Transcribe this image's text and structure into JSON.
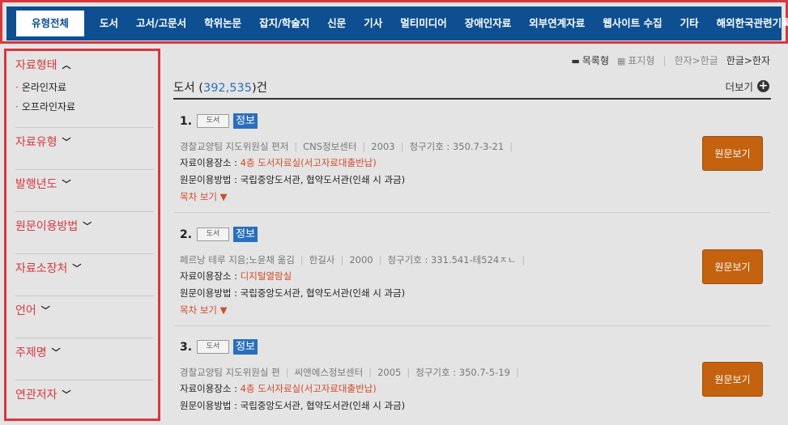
{
  "nav": {
    "tabs": [
      "유형전체",
      "도서",
      "고서/고문서",
      "학위논문",
      "잡지/학술지",
      "신문",
      "기사",
      "멀티미디어",
      "장애인자료",
      "외부연계자료",
      "웹사이트 수집",
      "기타",
      "해외한국관련기록물"
    ],
    "active_index": 0
  },
  "sidebar": {
    "filters": [
      {
        "label": "자료형태",
        "expanded": true,
        "options": [
          "온라인자료",
          "오프라인자료"
        ]
      },
      {
        "label": "자료유형",
        "expanded": false
      },
      {
        "label": "발행년도",
        "expanded": false
      },
      {
        "label": "원문이용방법",
        "expanded": false
      },
      {
        "label": "자료소장처",
        "expanded": false
      },
      {
        "label": "언어",
        "expanded": false
      },
      {
        "label": "주제명",
        "expanded": false
      },
      {
        "label": "연관저자",
        "expanded": false
      }
    ]
  },
  "view": {
    "list_label": "목록형",
    "card_label": "표지형",
    "hanja_to_hangul": "한자>한글",
    "hangul_to_hanja": "한글>한자",
    "active_view": "목록형"
  },
  "results_header": {
    "category": "도서",
    "count": "392,535",
    "suffix": "건",
    "more_label": "더보기"
  },
  "results": [
    {
      "no": "1.",
      "type_badge": "도서",
      "title": "정보",
      "meta": [
        "경찰교양팀 지도위원실 편저",
        "CNS정보센터",
        "2003",
        "청구기호 : 350.7-3-21"
      ],
      "location_label": "자료이용장소 :",
      "location_value": "4층 도서자료실(서고자료대출반납)",
      "method_label": "원문이용방법 :",
      "method_value": "국립중앙도서관, 협약도서관(인쇄 시 과금)",
      "toc_label": "목차 보기 ▼",
      "button_label": "원문보기"
    },
    {
      "no": "2.",
      "type_badge": "도서",
      "title": "정보",
      "meta": [
        "페르낭 테루 지음;노윤채 옮김",
        "한길사",
        "2000",
        "청구기호 : 331.541-테524ㅈㄴ"
      ],
      "location_label": "자료이용장소 :",
      "location_value": "디지털열람실",
      "method_label": "원문이용방법 :",
      "method_value": "국립중앙도서관, 협약도서관(인쇄 시 과금)",
      "toc_label": "목차 보기 ▼",
      "button_label": "원문보기"
    },
    {
      "no": "3.",
      "type_badge": "도서",
      "title": "정보",
      "meta": [
        "경찰교양팀 지도위원실 편",
        "씨앤에스정보센터",
        "2005",
        "청구기호 : 350.7-5-19"
      ],
      "location_label": "자료이용장소 :",
      "location_value": "4층 도서자료실(서고자료대출반납)",
      "method_label": "원문이용방법 :",
      "method_value": "국립중앙도서관, 협약도서관(인쇄 시 과금)",
      "button_label": "원문보기"
    }
  ]
}
